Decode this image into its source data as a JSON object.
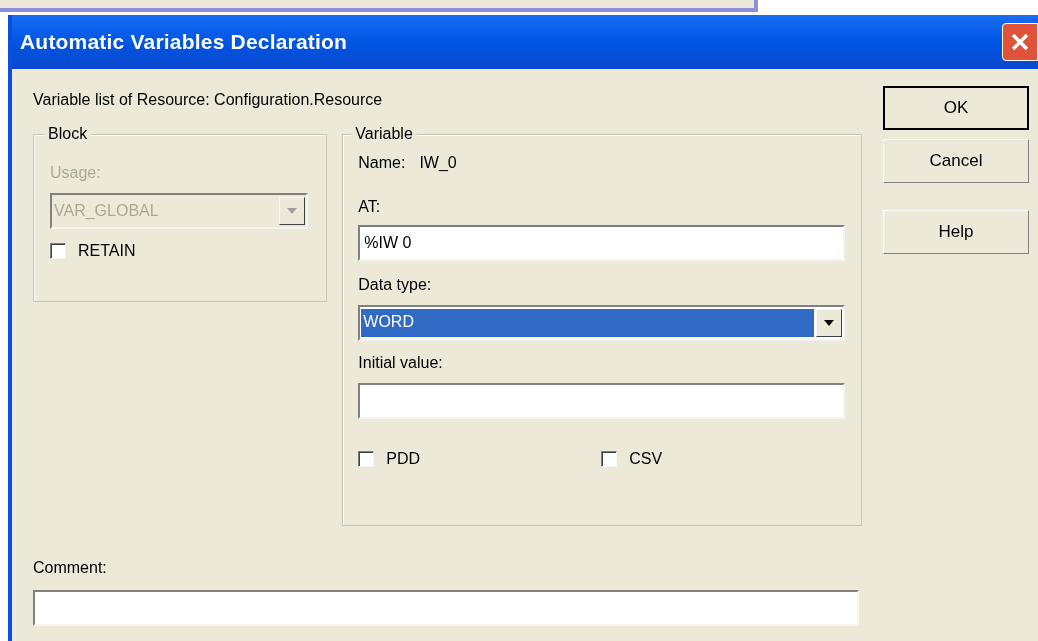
{
  "window": {
    "title": "Automatic Variables Declaration"
  },
  "header": "Variable list of Resource: Configuration.Resource",
  "block": {
    "legend": "Block",
    "usage_label": "Usage:",
    "usage": {
      "value": "VAR_GLOBAL",
      "disabled": true
    },
    "checkboxes": [
      {
        "label": "RETAIN",
        "checked": false
      }
    ]
  },
  "variable": {
    "legend": "Variable",
    "name_label": "Name:",
    "name": "IW_0",
    "at_label": "AT:",
    "at": "%IW 0",
    "data_type_label": "Data type:",
    "data_type": {
      "value": "WORD",
      "selected": true
    },
    "initial_value_label": "Initial value:",
    "checkboxes": [
      {
        "label": "PDD",
        "checked": false
      },
      {
        "label": "CSV",
        "checked": false
      }
    ]
  },
  "comment_label": "Comment:",
  "buttons": [
    {
      "label": "OK",
      "default": true
    },
    {
      "label": "Cancel",
      "default": false
    },
    {
      "label": "Help",
      "default": false
    }
  ]
}
